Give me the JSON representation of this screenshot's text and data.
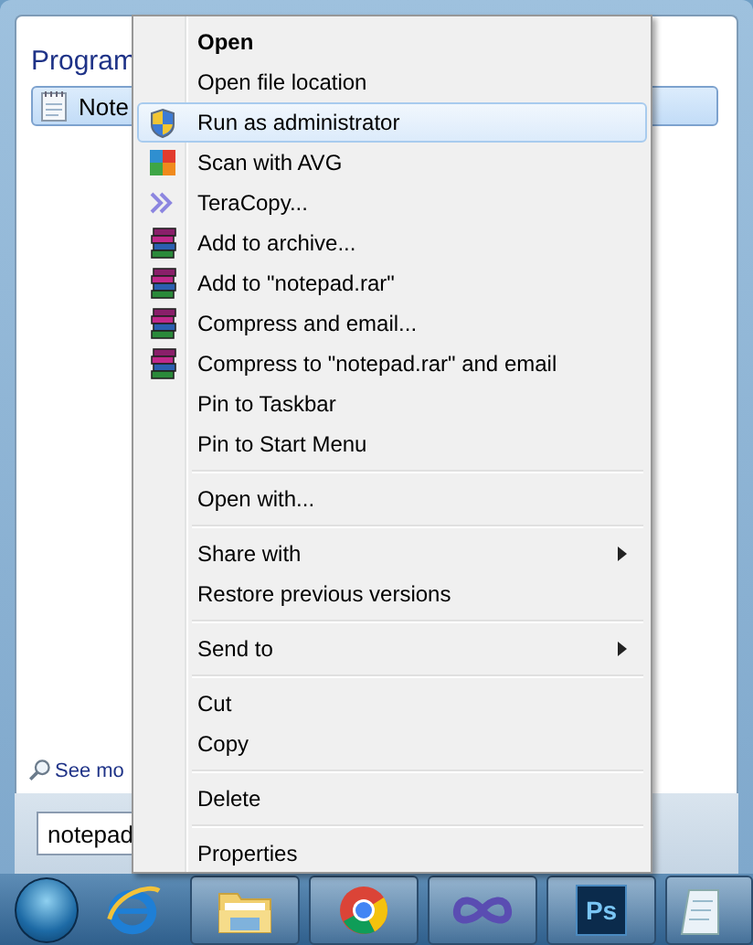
{
  "start_menu": {
    "section_heading": "Program",
    "result": {
      "label": "Note",
      "selected": true
    },
    "see_more": "See mo",
    "search": {
      "value": "notepad"
    }
  },
  "context_menu": [
    {
      "kind": "plain",
      "label": "Open",
      "bold": true,
      "submenu": false,
      "selected": false
    },
    {
      "kind": "plain",
      "label": "Open file location",
      "bold": false,
      "submenu": false,
      "selected": false
    },
    {
      "kind": "shield",
      "label": "Run as administrator",
      "bold": false,
      "submenu": false,
      "selected": true
    },
    {
      "kind": "scan",
      "label": "Scan with AVG",
      "bold": false,
      "submenu": false,
      "selected": false
    },
    {
      "kind": "chevrons",
      "label": "TeraCopy...",
      "bold": false,
      "submenu": false,
      "selected": false
    },
    {
      "kind": "archive",
      "label": "Add to archive...",
      "bold": false,
      "submenu": false,
      "selected": false
    },
    {
      "kind": "archive",
      "label": "Add to \"notepad.rar\"",
      "bold": false,
      "submenu": false,
      "selected": false
    },
    {
      "kind": "archive",
      "label": "Compress and email...",
      "bold": false,
      "submenu": false,
      "selected": false
    },
    {
      "kind": "archive",
      "label": "Compress to \"notepad.rar\" and email",
      "bold": false,
      "submenu": false,
      "selected": false
    },
    {
      "kind": "plain",
      "label": "Pin to Taskbar",
      "bold": false,
      "submenu": false,
      "selected": false
    },
    {
      "kind": "plain",
      "label": "Pin to Start Menu",
      "bold": false,
      "submenu": false,
      "selected": false
    },
    {
      "kind": "separator"
    },
    {
      "kind": "plain",
      "label": "Open with...",
      "bold": false,
      "submenu": false,
      "selected": false
    },
    {
      "kind": "separator"
    },
    {
      "kind": "plain",
      "label": "Share with",
      "bold": false,
      "submenu": true,
      "selected": false
    },
    {
      "kind": "plain",
      "label": "Restore previous versions",
      "bold": false,
      "submenu": false,
      "selected": false
    },
    {
      "kind": "separator"
    },
    {
      "kind": "plain",
      "label": "Send to",
      "bold": false,
      "submenu": true,
      "selected": false
    },
    {
      "kind": "separator"
    },
    {
      "kind": "plain",
      "label": "Cut",
      "bold": false,
      "submenu": false,
      "selected": false
    },
    {
      "kind": "plain",
      "label": "Copy",
      "bold": false,
      "submenu": false,
      "selected": false
    },
    {
      "kind": "separator"
    },
    {
      "kind": "plain",
      "label": "Delete",
      "bold": false,
      "submenu": false,
      "selected": false
    },
    {
      "kind": "separator"
    },
    {
      "kind": "plain",
      "label": "Properties",
      "bold": false,
      "submenu": false,
      "selected": false
    }
  ],
  "taskbar": [
    {
      "kind": "start"
    },
    {
      "kind": "browser-e"
    },
    {
      "kind": "folder"
    },
    {
      "kind": "chrome"
    },
    {
      "kind": "infinity"
    },
    {
      "kind": "ps",
      "label": "Ps"
    },
    {
      "kind": "notepad"
    }
  ]
}
